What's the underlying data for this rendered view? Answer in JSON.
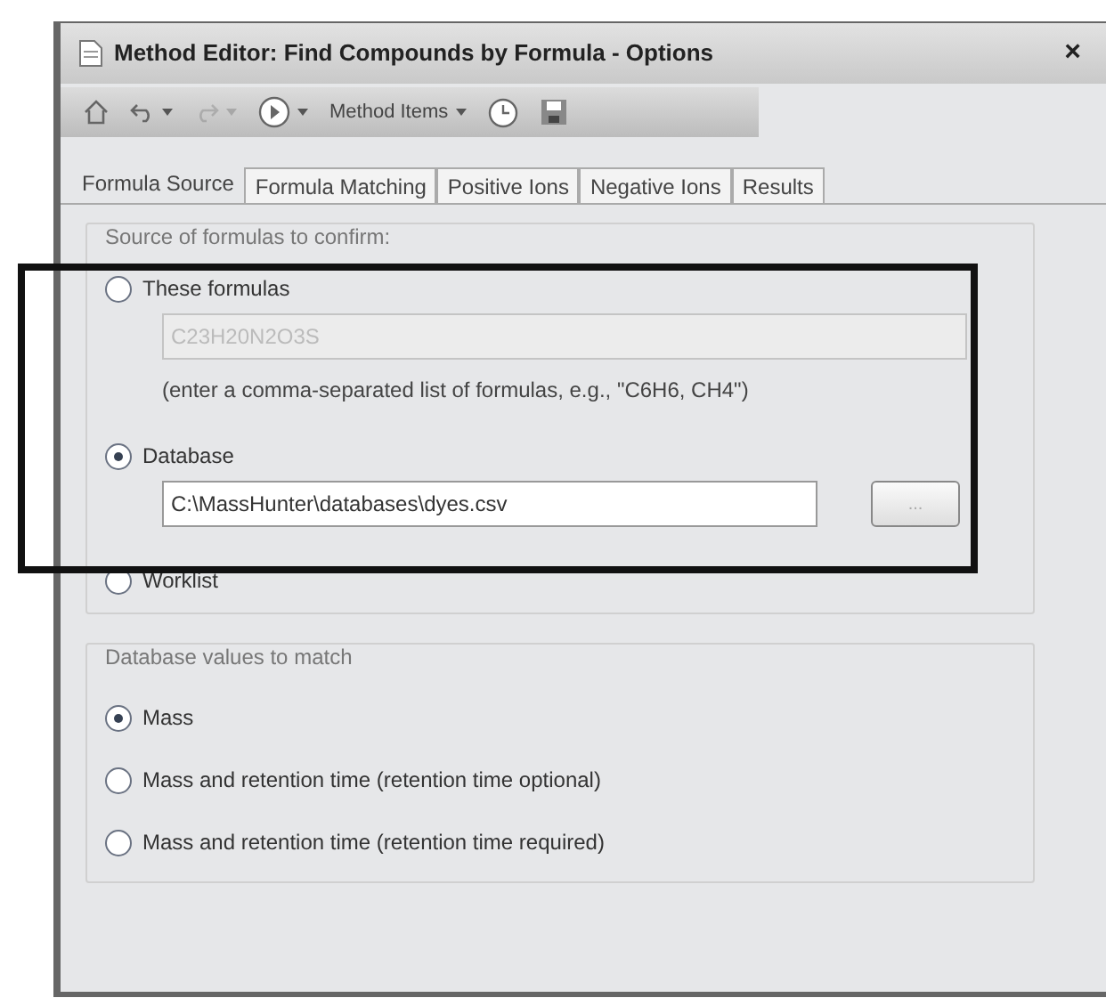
{
  "window": {
    "title": "Method Editor: Find Compounds by Formula - Options",
    "close": "×"
  },
  "toolbar": [
    {
      "kind": "home",
      "disabled": false,
      "dropdown": false
    },
    {
      "kind": "undo",
      "disabled": false,
      "dropdown": true
    },
    {
      "kind": "redo",
      "disabled": true,
      "dropdown": true
    },
    {
      "kind": "run",
      "disabled": false,
      "dropdown": true
    },
    {
      "kind": "menu",
      "label": "Method Items",
      "disabled": false,
      "dropdown": true
    },
    {
      "kind": "clock",
      "disabled": false,
      "dropdown": false
    },
    {
      "kind": "save",
      "disabled": false,
      "dropdown": false
    }
  ],
  "tabs": [
    {
      "label": "Formula Source",
      "selected": true
    },
    {
      "label": "Formula Matching",
      "selected": false
    },
    {
      "label": "Positive Ions",
      "selected": false
    },
    {
      "label": "Negative Ions",
      "selected": false
    },
    {
      "label": "Results",
      "selected": false
    }
  ],
  "source_group": {
    "title": "Source of formulas to confirm:",
    "these_formulas": {
      "label": "These formulas",
      "selected": false,
      "value": "C23H20N2O3S",
      "disabled": true,
      "hint": "(enter a comma-separated list of formulas, e.g., \"C6H6, CH4\")"
    },
    "database": {
      "label": "Database",
      "selected": true,
      "value": "C:\\MassHunter\\databases\\dyes.csv",
      "button": "..."
    },
    "worklist": {
      "label": "Worklist",
      "selected": false
    }
  },
  "match_group": {
    "title": "Database values to match",
    "options": [
      {
        "label": "Mass",
        "selected": true
      },
      {
        "label": "Mass and retention time (retention time optional)",
        "selected": false
      },
      {
        "label": "Mass and retention time (retention time required)",
        "selected": false
      }
    ]
  }
}
